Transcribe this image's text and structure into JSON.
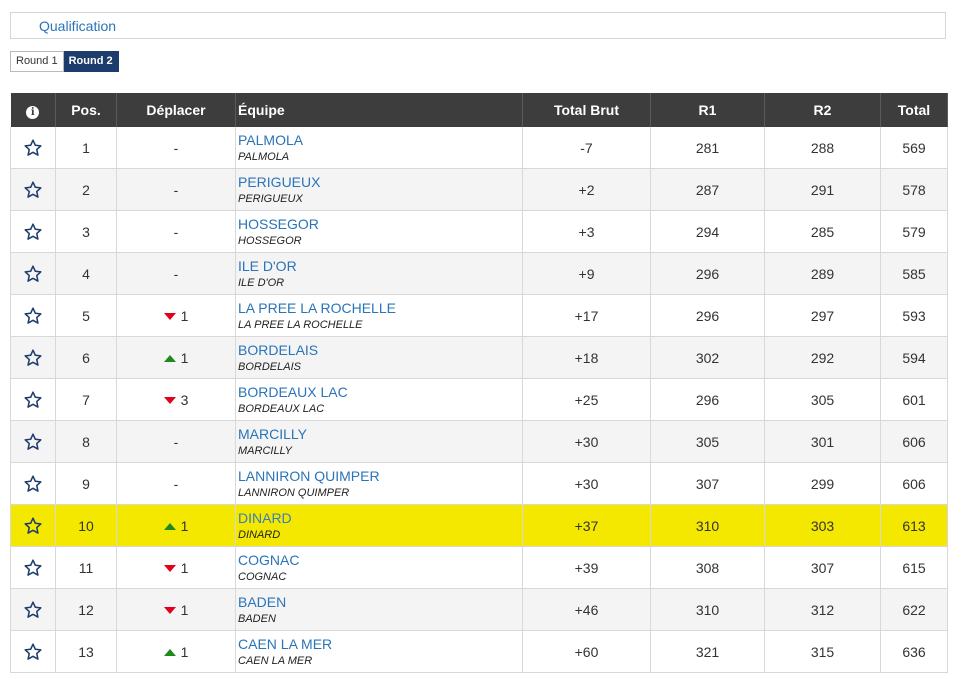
{
  "header": {
    "title": "Qualification"
  },
  "rounds": [
    {
      "label": "Round 1",
      "active": false
    },
    {
      "label": "Round 2",
      "active": true
    }
  ],
  "columns": {
    "info": "i",
    "pos": "Pos.",
    "move": "Déplacer",
    "team": "Équipe",
    "total_brut": "Total Brut",
    "r1": "R1",
    "r2": "R2",
    "total": "Total"
  },
  "colors": {
    "under_par": "#e3001b",
    "best_round": "#2d9a2d",
    "header_bg": "#3d3d3d",
    "highlight": "#f4e800",
    "link": "#2a74b8"
  },
  "rows": [
    {
      "pos": "1",
      "move_dir": "none",
      "move": "-",
      "team": "PALMOLA",
      "club": "PALMOLA",
      "total_brut": "-7",
      "r1": "281",
      "r2": "288",
      "total": "569",
      "brut_color": "red",
      "r1_color": "red",
      "r2_color": "green",
      "total_color": "red",
      "highlight": false
    },
    {
      "pos": "2",
      "move_dir": "none",
      "move": "-",
      "team": "PERIGUEUX",
      "club": "PERIGUEUX",
      "total_brut": "+2",
      "r1": "287",
      "r2": "291",
      "total": "578",
      "r1_color": "red",
      "highlight": false
    },
    {
      "pos": "3",
      "move_dir": "none",
      "move": "-",
      "team": "HOSSEGOR",
      "club": "HOSSEGOR",
      "total_brut": "+3",
      "r1": "294",
      "r2": "285",
      "total": "579",
      "r2_color": "red",
      "highlight": false
    },
    {
      "pos": "4",
      "move_dir": "none",
      "move": "-",
      "team": "ILE D'OR",
      "club": "ILE D'OR",
      "total_brut": "+9",
      "r1": "296",
      "r2": "289",
      "total": "585",
      "highlight": false
    },
    {
      "pos": "5",
      "move_dir": "down",
      "move": "1",
      "team": "LA PREE LA ROCHELLE",
      "club": "LA PREE LA ROCHELLE",
      "total_brut": "+17",
      "r1": "296",
      "r2": "297",
      "total": "593",
      "highlight": false
    },
    {
      "pos": "6",
      "move_dir": "up",
      "move": "1",
      "team": "BORDELAIS",
      "club": "BORDELAIS",
      "total_brut": "+18",
      "r1": "302",
      "r2": "292",
      "total": "594",
      "highlight": false
    },
    {
      "pos": "7",
      "move_dir": "down",
      "move": "3",
      "team": "BORDEAUX LAC",
      "club": "BORDEAUX LAC",
      "total_brut": "+25",
      "r1": "296",
      "r2": "305",
      "total": "601",
      "highlight": false
    },
    {
      "pos": "8",
      "move_dir": "none",
      "move": "-",
      "team": "MARCILLY",
      "club": "MARCILLY",
      "total_brut": "+30",
      "r1": "305",
      "r2": "301",
      "total": "606",
      "highlight": false
    },
    {
      "pos": "9",
      "move_dir": "none",
      "move": "-",
      "team": "LANNIRON QUIMPER",
      "club": "LANNIRON QUIMPER",
      "total_brut": "+30",
      "r1": "307",
      "r2": "299",
      "total": "606",
      "highlight": false
    },
    {
      "pos": "10",
      "move_dir": "up",
      "move": "1",
      "team": "DINARD",
      "club": "DINARD",
      "total_brut": "+37",
      "r1": "310",
      "r2": "303",
      "total": "613",
      "highlight": true
    },
    {
      "pos": "11",
      "move_dir": "down",
      "move": "1",
      "team": "COGNAC",
      "club": "COGNAC",
      "total_brut": "+39",
      "r1": "308",
      "r2": "307",
      "total": "615",
      "highlight": false
    },
    {
      "pos": "12",
      "move_dir": "down",
      "move": "1",
      "team": "BADEN",
      "club": "BADEN",
      "total_brut": "+46",
      "r1": "310",
      "r2": "312",
      "total": "622",
      "highlight": false
    },
    {
      "pos": "13",
      "move_dir": "up",
      "move": "1",
      "team": "CAEN LA MER",
      "club": "CAEN LA MER",
      "total_brut": "+60",
      "r1": "321",
      "r2": "315",
      "total": "636",
      "highlight": false
    }
  ]
}
